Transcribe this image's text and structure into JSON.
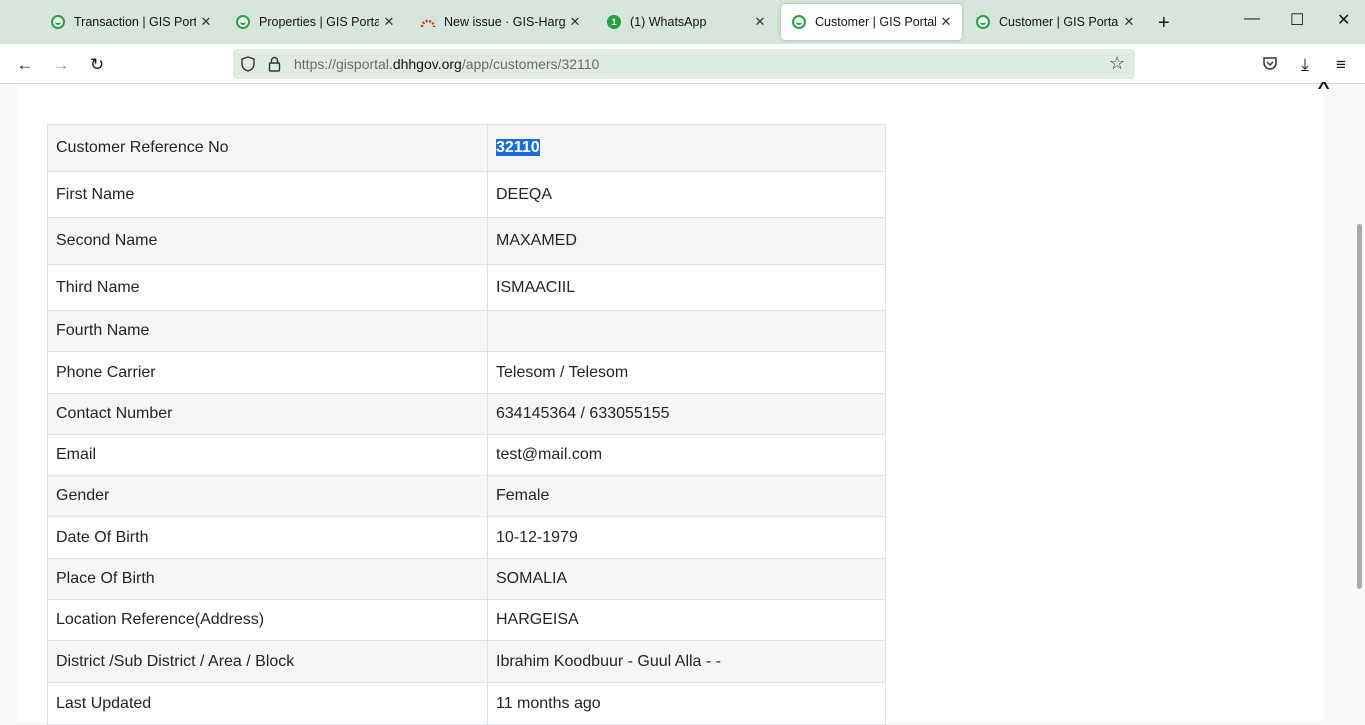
{
  "tabs": [
    {
      "title": "Transaction | GIS Portal",
      "icon": "gis-portal-icon"
    },
    {
      "title": "Properties | GIS Portal",
      "icon": "gis-portal-icon"
    },
    {
      "title": "New issue · GIS-Hargesi",
      "icon": "gitlab-icon"
    },
    {
      "title": "(1) WhatsApp",
      "icon": "whatsapp-icon",
      "badge": "1"
    },
    {
      "title": "Customer | GIS Portal",
      "icon": "gis-portal-icon",
      "active": true
    },
    {
      "title": "Customer | GIS Portal",
      "icon": "gis-portal-icon"
    }
  ],
  "url": {
    "prefix": "https://gisportal.",
    "domain": "dhhgov.org",
    "path": "/app/customers/32110"
  },
  "customer": {
    "rows": [
      {
        "label": "Customer Reference No",
        "value": "32110"
      },
      {
        "label": "First Name",
        "value": "DEEQA"
      },
      {
        "label": "Second Name",
        "value": "MAXAMED"
      },
      {
        "label": "Third Name",
        "value": "ISMAACIIL"
      },
      {
        "label": "Fourth Name",
        "value": ""
      },
      {
        "label": "Phone Carrier",
        "value": "Telesom / Telesom"
      },
      {
        "label": "Contact Number",
        "value": "634145364 / 633055155"
      },
      {
        "label": "Email",
        "value": "test@mail.com"
      },
      {
        "label": "Gender",
        "value": "Female"
      },
      {
        "label": "Date Of Birth",
        "value": "10-12-1979"
      },
      {
        "label": "Place Of Birth",
        "value": "SOMALIA"
      },
      {
        "label": "Location Reference(Address)",
        "value": "HARGEISA"
      },
      {
        "label": "District /Sub District / Area / Block",
        "value": "Ibrahim Koodbuur - Guul Alla - -"
      },
      {
        "label": "Last Updated",
        "value": "11 months ago"
      }
    ]
  },
  "colors": {
    "accent_green": "#2e9d4a",
    "selection": "#1a6ed8",
    "tabbar": "#d6e6da"
  }
}
